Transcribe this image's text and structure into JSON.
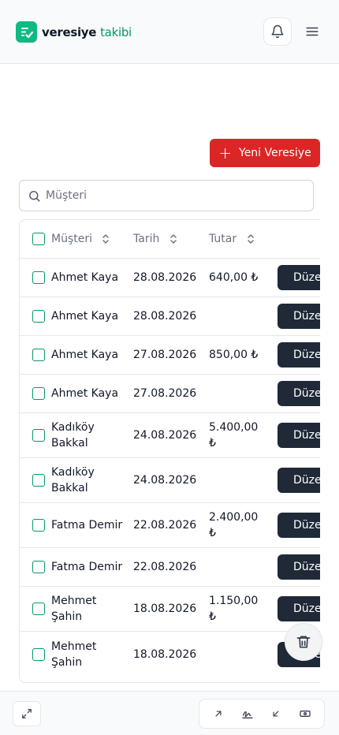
{
  "app": {
    "logo_bold": "veresiye",
    "logo_light": "takibi"
  },
  "actions": {
    "new_label": "Yeni Veresiye"
  },
  "search": {
    "placeholder": "Müşteri"
  },
  "table": {
    "headers": {
      "customer": "Müşteri",
      "date": "Tarih",
      "amount": "Tutar"
    },
    "edit_label": "Düzenle",
    "rows": [
      {
        "customer": "Ahmet Kaya",
        "date": "28.08.2026",
        "amount": "640,00 ₺"
      },
      {
        "customer": "Ahmet Kaya",
        "date": "28.08.2026",
        "amount": ""
      },
      {
        "customer": "Ahmet Kaya",
        "date": "27.08.2026",
        "amount": "850,00 ₺"
      },
      {
        "customer": "Ahmet Kaya",
        "date": "27.08.2026",
        "amount": ""
      },
      {
        "customer": "Kadıköy Bakkal",
        "date": "24.08.2026",
        "amount": "5.400,00 ₺"
      },
      {
        "customer": "Kadıköy Bakkal",
        "date": "24.08.2026",
        "amount": ""
      },
      {
        "customer": "Fatma Demir",
        "date": "22.08.2026",
        "amount": "2.400,00 ₺"
      },
      {
        "customer": "Fatma Demir",
        "date": "22.08.2026",
        "amount": ""
      },
      {
        "customer": "Mehmet Şahin",
        "date": "18.08.2026",
        "amount": "1.150,00 ₺"
      },
      {
        "customer": "Mehmet Şahin",
        "date": "18.08.2026",
        "amount": ""
      }
    ]
  },
  "icons": {
    "bell": "bell-icon",
    "menu": "hamburger-menu-icon",
    "search": "search-icon",
    "sort": "sort-icon",
    "edit": "edit-icon",
    "trash": "trash-icon",
    "expand": "expand-icon",
    "tools": [
      "arrow-up-right-icon",
      "signature-icon",
      "arrow-down-left-icon",
      "cash-icon"
    ]
  },
  "colors": {
    "brand": "#10b981",
    "primary_action": "#dc2626",
    "edit_button": "#1f2937",
    "checkbox_border": "#059669"
  }
}
